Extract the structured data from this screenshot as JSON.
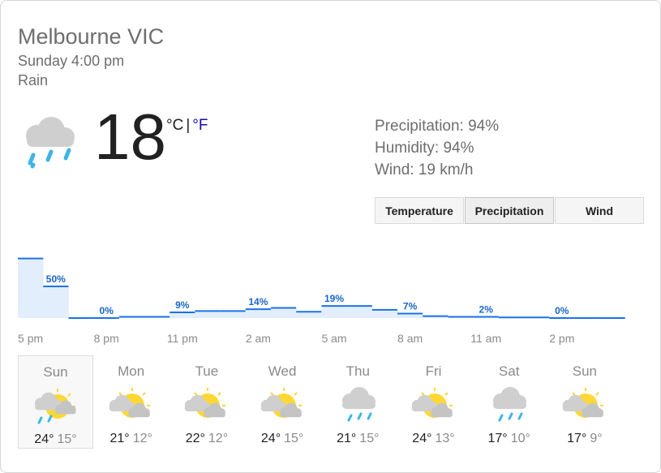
{
  "header": {
    "location": "Melbourne VIC",
    "datetime": "Sunday 4:00 pm",
    "condition": "Rain"
  },
  "current": {
    "icon": "rain-cloud-icon",
    "temperature": "18",
    "unit_c": "°C",
    "unit_sep": "|",
    "unit_f": "°F"
  },
  "details": {
    "precipitation": "Precipitation: 94%",
    "humidity": "Humidity: 94%",
    "wind": "Wind: 19 km/h"
  },
  "tabs": [
    {
      "label": "Temperature",
      "active": false
    },
    {
      "label": "Precipitation",
      "active": true
    },
    {
      "label": "Wind",
      "active": false
    }
  ],
  "colors": {
    "line": "#1a73e8",
    "fill": "#e3eefc",
    "label": "#1a66c9"
  },
  "chart_data": {
    "type": "area",
    "x": [
      "5 pm",
      "6 pm",
      "7 pm",
      "8 pm",
      "9 pm",
      "10 pm",
      "11 pm",
      "12 am",
      "1 am",
      "2 am",
      "3 am",
      "4 am",
      "5 am",
      "6 am",
      "7 am",
      "8 am",
      "9 am",
      "10 am",
      "11 am",
      "12 pm",
      "1 pm",
      "2 pm",
      "3 pm",
      "4 pm"
    ],
    "values": [
      94,
      50,
      0,
      0,
      2,
      2,
      9,
      11,
      11,
      14,
      16,
      10,
      19,
      19,
      13,
      7,
      3,
      2,
      2,
      1,
      1,
      0,
      0,
      0
    ],
    "labels": [
      "50%",
      "0%",
      "9%",
      "14%",
      "19%",
      "7%",
      "2%",
      "0%"
    ],
    "label_index": [
      1,
      3,
      6,
      9,
      12,
      15,
      18,
      21
    ],
    "tick_labels": [
      "5 pm",
      "8 pm",
      "11 pm",
      "2 am",
      "5 am",
      "8 am",
      "11 am",
      "2 pm"
    ],
    "tick_index": [
      0,
      3,
      6,
      9,
      12,
      15,
      18,
      21
    ],
    "ylim": [
      0,
      100
    ],
    "unit": "%"
  },
  "forecast": [
    {
      "day": "Sun",
      "icon": "rain-partly-sunny-icon",
      "hi": "24°",
      "lo": "15°",
      "selected": true
    },
    {
      "day": "Mon",
      "icon": "partly-cloudy-icon",
      "hi": "21°",
      "lo": "12°",
      "selected": false
    },
    {
      "day": "Tue",
      "icon": "partly-cloudy-icon",
      "hi": "22°",
      "lo": "12°",
      "selected": false
    },
    {
      "day": "Wed",
      "icon": "partly-cloudy-icon",
      "hi": "24°",
      "lo": "15°",
      "selected": false
    },
    {
      "day": "Thu",
      "icon": "rain-cloud-icon",
      "hi": "21°",
      "lo": "15°",
      "selected": false
    },
    {
      "day": "Fri",
      "icon": "partly-cloudy-icon",
      "hi": "24°",
      "lo": "13°",
      "selected": false
    },
    {
      "day": "Sat",
      "icon": "rain-cloud-icon",
      "hi": "17°",
      "lo": "10°",
      "selected": false
    },
    {
      "day": "Sun",
      "icon": "partly-cloudy-icon",
      "hi": "17°",
      "lo": "9°",
      "selected": false
    }
  ]
}
